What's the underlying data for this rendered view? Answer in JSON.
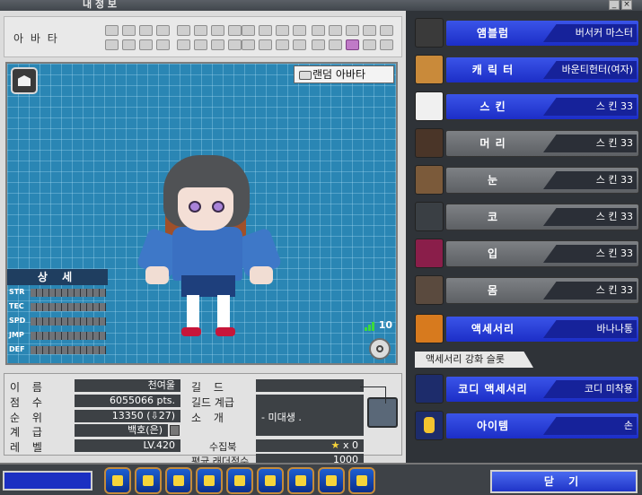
{
  "window": {
    "title": "내 정 보"
  },
  "avatar_row": {
    "label": "아 바 타"
  },
  "stage": {
    "random_button": "랜덤 아바타",
    "signal_value": "10"
  },
  "detail": {
    "title": "상 세",
    "stats": [
      "STR",
      "TEC",
      "SPD",
      "JMP",
      "DEF"
    ]
  },
  "info": {
    "labels": {
      "name": "이 름",
      "score": "점 수",
      "rank": "순 위",
      "grade": "계 급",
      "level": "레 벨",
      "guild": "길 드",
      "guild_grade": "길드 계급",
      "intro": "소 개",
      "collection": "수집북",
      "ladder": "평균 래더점수"
    },
    "values": {
      "name": "천여울",
      "score": "6055066 pts.",
      "rank": "13350 (⇩27)",
      "grade": "백호(은)",
      "level": "LV.420",
      "guild": "",
      "guild_grade": "",
      "intro": "- 미대생 .",
      "collection": "x 0",
      "ladder": "1000"
    }
  },
  "right_panel": {
    "rows": [
      {
        "category": "앰블럼",
        "value": "버서커 마스터",
        "active": true,
        "icon": "emblem-icon"
      },
      {
        "category": "캐 릭 터",
        "value": "바운티헌터(여자)",
        "active": true,
        "icon": "character-icon"
      },
      {
        "category": "스 킨",
        "value": "스 킨 33",
        "active": true,
        "icon": "skin-icon"
      },
      {
        "category": "머 리",
        "value": "스 킨 33",
        "active": false,
        "icon": "hair-icon"
      },
      {
        "category": "눈",
        "value": "스 킨 33",
        "active": false,
        "icon": "eye-icon"
      },
      {
        "category": "코",
        "value": "스 킨 33",
        "active": false,
        "icon": "nose-icon"
      },
      {
        "category": "입",
        "value": "스 킨 33",
        "active": false,
        "icon": "mouth-icon"
      },
      {
        "category": "몸",
        "value": "스 킨 33",
        "active": false,
        "icon": "body-icon"
      },
      {
        "category": "액세서리",
        "value": "바나나통",
        "active": true,
        "icon": "accessory-icon"
      }
    ],
    "accessory_upgrade_label": "액세서리 강화 슬롯",
    "codi": {
      "category": "코디 액세서리",
      "value": "코디 미착용"
    },
    "item": {
      "category": "아이템",
      "value": "손"
    }
  },
  "bottom": {
    "close_label": "닫 기"
  },
  "colors": {
    "accent_blue": "#1f34c7",
    "stage_blue": "#2a86b4",
    "panel_gray": "#dcdcdc"
  }
}
